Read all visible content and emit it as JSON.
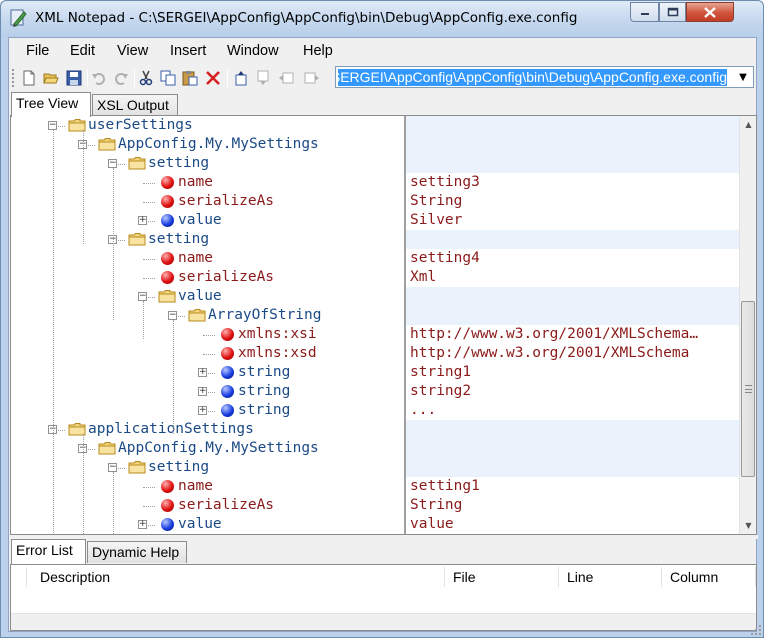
{
  "window": {
    "title": "XML Notepad - C:\\SERGEI\\AppConfig\\AppConfig\\bin\\Debug\\AppConfig.exe.config"
  },
  "menu": {
    "items": [
      "File",
      "Edit",
      "View",
      "Insert",
      "Window",
      "Help"
    ]
  },
  "toolbar": {
    "buttons": [
      "new-icon",
      "open-icon",
      "save-icon",
      "undo-icon",
      "redo-icon",
      "cut-icon",
      "copy-icon",
      "paste-icon",
      "delete-icon",
      "nudge-up-icon",
      "nudge-down-icon",
      "nudge-left-icon",
      "nudge-right-icon"
    ],
    "location": "C:\\SERGEI\\AppConfig\\AppConfig\\bin\\Debug\\AppConfig.exe.config"
  },
  "tabs": {
    "tree_view": "Tree View",
    "xsl_output": "XSL Output"
  },
  "tree": {
    "nodes": [
      {
        "label": "userSettings",
        "kind": "element",
        "value": ""
      },
      {
        "label": "AppConfig.My.MySettings",
        "kind": "element",
        "value": ""
      },
      {
        "label": "setting",
        "kind": "element",
        "value": ""
      },
      {
        "label": "name",
        "kind": "attribute",
        "value": "setting3"
      },
      {
        "label": "serializeAs",
        "kind": "attribute",
        "value": "String"
      },
      {
        "label": "value",
        "kind": "text-element",
        "value": "Silver"
      },
      {
        "label": "setting",
        "kind": "element",
        "value": ""
      },
      {
        "label": "name",
        "kind": "attribute",
        "value": "setting4"
      },
      {
        "label": "serializeAs",
        "kind": "attribute",
        "value": "Xml"
      },
      {
        "label": "value",
        "kind": "element",
        "value": ""
      },
      {
        "label": "ArrayOfString",
        "kind": "element",
        "value": ""
      },
      {
        "label": "xmlns:xsi",
        "kind": "attribute",
        "value": "http://www.w3.org/2001/XMLSchema…"
      },
      {
        "label": "xmlns:xsd",
        "kind": "attribute",
        "value": "http://www.w3.org/2001/XMLSchema"
      },
      {
        "label": "string",
        "kind": "text-element",
        "value": "string1"
      },
      {
        "label": "string",
        "kind": "text-element",
        "value": "string2"
      },
      {
        "label": "string",
        "kind": "text-element",
        "value": "..."
      },
      {
        "label": "applicationSettings",
        "kind": "element",
        "value": ""
      },
      {
        "label": "AppConfig.My.MySettings",
        "kind": "element",
        "value": ""
      },
      {
        "label": "setting",
        "kind": "element",
        "value": ""
      },
      {
        "label": "name",
        "kind": "attribute",
        "value": "setting1"
      },
      {
        "label": "serializeAs",
        "kind": "attribute",
        "value": "String"
      },
      {
        "label": "value",
        "kind": "text-element",
        "value": "value"
      }
    ]
  },
  "bottom_tabs": {
    "error_list": "Error List",
    "dynamic_help": "Dynamic Help"
  },
  "error_list": {
    "columns": [
      "Description",
      "File",
      "Line",
      "Column"
    ]
  },
  "colors": {
    "element_text": "#1a4a86",
    "attribute_text": "#8b1a1a",
    "selection": "#3399ff"
  }
}
